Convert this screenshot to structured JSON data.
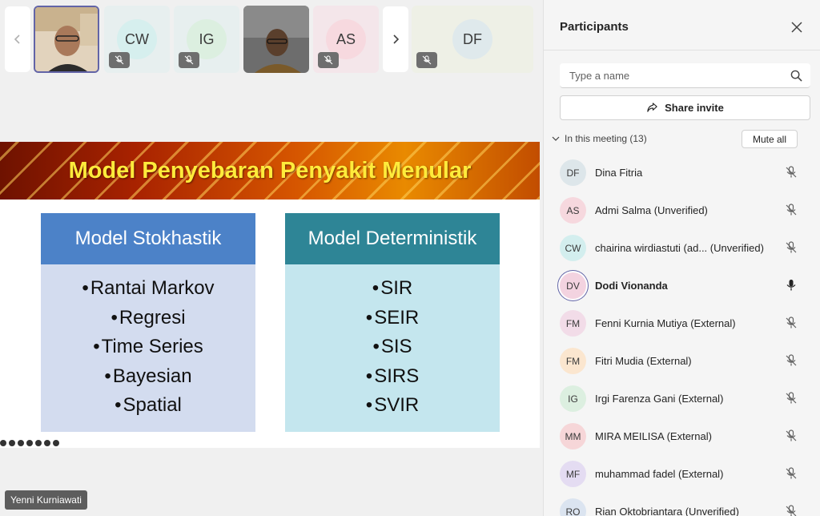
{
  "tiles": [
    {
      "kind": "video",
      "initials": "",
      "color": "#8a6a50"
    },
    {
      "kind": "initials",
      "initials": "CW",
      "color": "#d6efee"
    },
    {
      "kind": "initials",
      "initials": "IG",
      "color": "#dcefe0"
    },
    {
      "kind": "video",
      "initials": "",
      "color": "#5a5a5a"
    },
    {
      "kind": "initials",
      "initials": "AS",
      "color": "#f7d9df"
    },
    {
      "kind": "initials",
      "initials": "DF",
      "color": "#dfe9ec"
    }
  ],
  "slide": {
    "title": "Model Penyebaran Penyakit Menular",
    "left_column": {
      "heading": "Model Stokhastik",
      "items": [
        "Rantai Markov",
        "Regresi",
        "Time Series",
        "Bayesian",
        "Spatial"
      ]
    },
    "right_column": {
      "heading": "Model Deterministik",
      "items": [
        "SIR",
        "SEIR",
        "SIS",
        "SIRS",
        "SVIR"
      ]
    }
  },
  "speaker": "Yenni Kurniawati",
  "panel": {
    "title": "Participants",
    "search_placeholder": "Type a name",
    "share_label": "Share invite",
    "section_label": "In this meeting (13)",
    "mute_all_label": "Mute all",
    "participants": [
      {
        "initials": "DF",
        "name": "Dina Fitria",
        "muted": true,
        "bold": false,
        "avatar_color": "#dde6ea"
      },
      {
        "initials": "AS",
        "name": "Admi Salma (Unverified)",
        "muted": true,
        "bold": false,
        "avatar_color": "#f6d8de"
      },
      {
        "initials": "CW",
        "name": "chairina wirdiastuti (ad...  (Unverified)",
        "muted": true,
        "bold": false,
        "avatar_color": "#d3eeee"
      },
      {
        "initials": "DV",
        "name": "Dodi Vionanda",
        "muted": false,
        "bold": true,
        "avatar_color": "#f3d3e0"
      },
      {
        "initials": "FM",
        "name": "Fenni Kurnia Mutiya (External)",
        "muted": true,
        "bold": false,
        "avatar_color": "#f2dce8"
      },
      {
        "initials": "FM",
        "name": "Fitri Mudia (External)",
        "muted": true,
        "bold": false,
        "avatar_color": "#fbe6cf"
      },
      {
        "initials": "IG",
        "name": "Irgi Farenza Gani (External)",
        "muted": true,
        "bold": false,
        "avatar_color": "#dcefe0"
      },
      {
        "initials": "MM",
        "name": "MIRA MEILISA (External)",
        "muted": true,
        "bold": false,
        "avatar_color": "#f6d6d8"
      },
      {
        "initials": "MF",
        "name": "muhammad fadel (External)",
        "muted": true,
        "bold": false,
        "avatar_color": "#e4dcf2"
      },
      {
        "initials": "RO",
        "name": "Rian Oktobriantara (Unverified)",
        "muted": true,
        "bold": false,
        "avatar_color": "#dbe4f0"
      }
    ]
  }
}
